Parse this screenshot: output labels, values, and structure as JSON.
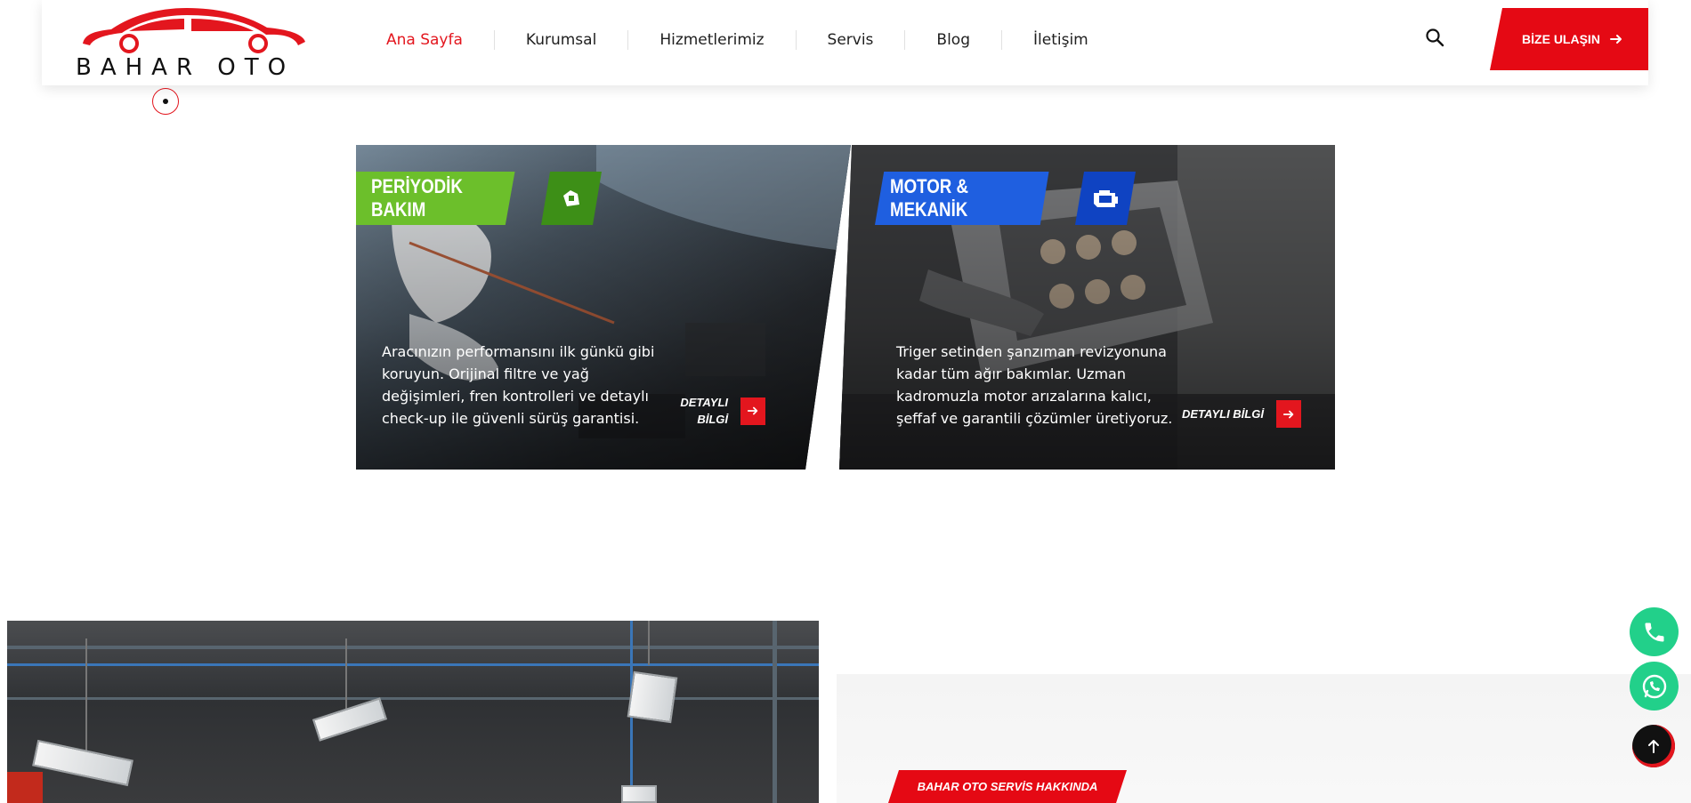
{
  "brand": {
    "name": "BAHAR OTO",
    "accent_color": "#e3161e",
    "cta_color": "#e50914"
  },
  "nav": {
    "items": [
      {
        "label": "Ana Sayfa",
        "active": true
      },
      {
        "label": "Kurumsal",
        "active": false
      },
      {
        "label": "Hizmetlerimiz",
        "active": false
      },
      {
        "label": "Servis",
        "active": false
      },
      {
        "label": "Blog",
        "active": false
      },
      {
        "label": "İletişim",
        "active": false
      }
    ],
    "search_icon": "search-icon",
    "cta_label": "BİZE ULAŞIN"
  },
  "services": [
    {
      "title": "PERİYODİK BAKIM",
      "tag_color": "#6cbf2b",
      "icon": "oil-can-icon",
      "description": "Aracınızın performansını ilk günkü gibi koruyun. Orijinal filtre ve yağ değişimleri, fren kontrolleri ve detaylı check-up ile güvenli sürüş garantisi.",
      "detail_label": "DETAYLI BİLGİ"
    },
    {
      "title": "MOTOR & MEKANİK",
      "tag_color": "#1f5fe0",
      "icon": "engine-icon",
      "description": "Triger setinden şanzıman revizyonuna kadar tüm ağır bakımlar. Uzman kadromuzla motor arızalarına kalıcı, şeffaf ve garantili çözümler üretiyoruz.",
      "detail_label": "DETAYLI BİLGİ"
    }
  ],
  "about": {
    "tag": "BAHAR OTO SERVİS HAKKINDA"
  },
  "floating": {
    "phone_icon": "phone-icon",
    "whatsapp_icon": "whatsapp-icon",
    "scroll_top_icon": "arrow-up-icon",
    "button_color": "#22d08a"
  }
}
